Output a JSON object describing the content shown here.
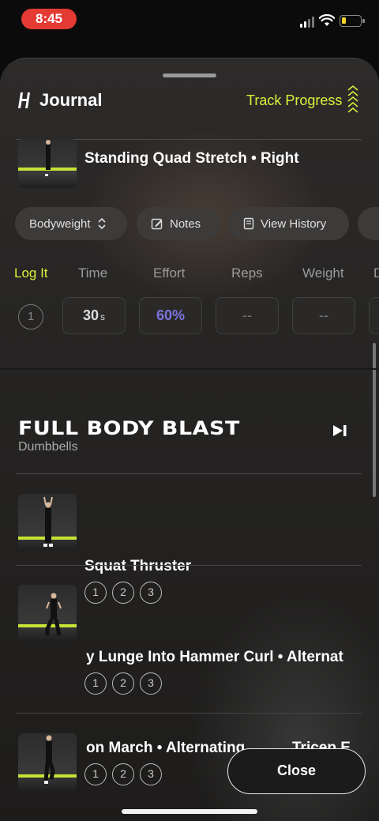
{
  "status_bar": {
    "time": "8:45",
    "battery_level": 0.15
  },
  "header": {
    "title": "Journal",
    "track_progress": "Track Progress",
    "accent": "#d8f23a"
  },
  "current_exercise": {
    "title": "Standing Quad Stretch • Right",
    "pills": [
      {
        "label": "Bodyweight",
        "icon": "sort-icon"
      },
      {
        "label": "Notes",
        "icon": "edit-icon"
      },
      {
        "label": "View History",
        "icon": "book-icon"
      }
    ],
    "columns": [
      "Log It",
      "Time",
      "Effort",
      "Reps",
      "Weight",
      "D"
    ],
    "set_number": "1",
    "time_value": "30",
    "time_unit": "s",
    "effort_value": "60%",
    "effort_color": "#7a73dd",
    "reps_value": "--",
    "weight_value": "--"
  },
  "section": {
    "title": "FULL BODY BLAST",
    "subtitle": "Dumbbells",
    "exercises": [
      {
        "title": "Squat Thruster",
        "sets": [
          "1",
          "2",
          "3"
        ]
      },
      {
        "title": "y Lunge Into Hammer Curl • Alternat",
        "sets": [
          "1",
          "2",
          "3"
        ]
      },
      {
        "title": "on March • Alternating",
        "title_next": "Tricep E",
        "sets": [
          "1",
          "2",
          "3"
        ]
      }
    ]
  },
  "close_label": "Close"
}
